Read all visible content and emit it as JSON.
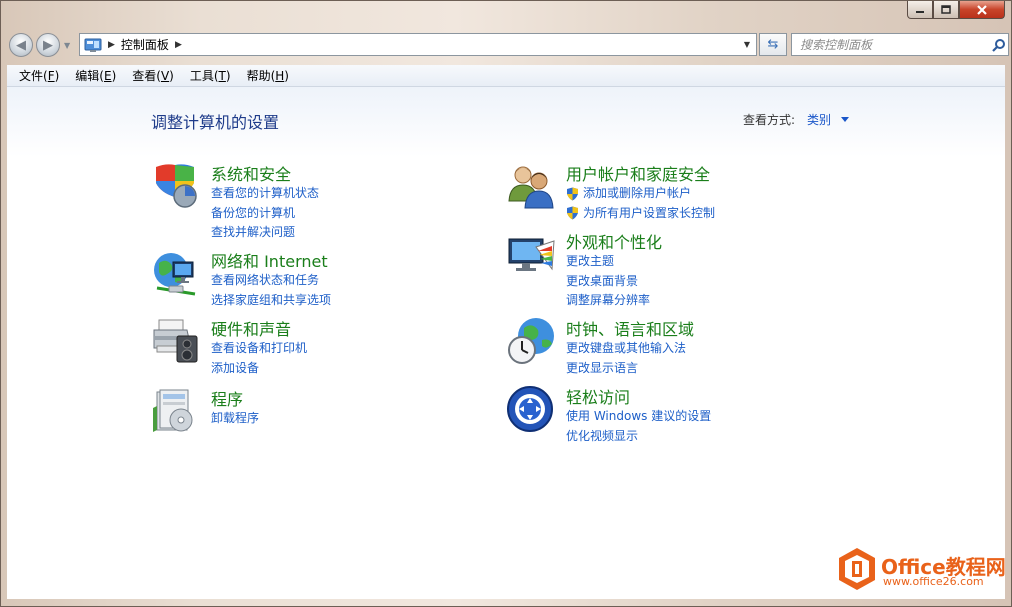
{
  "window": {
    "minimize_icon": "minimize-icon",
    "maximize_icon": "maximize-icon",
    "close_icon": "close-icon"
  },
  "nav": {
    "back_icon": "back-arrow-icon",
    "forward_icon": "forward-arrow-icon",
    "address": "控制面板",
    "search_placeholder": "搜索控制面板",
    "search_icon": "search-icon",
    "refresh_icon": "refresh-icon"
  },
  "menu": [
    "文件(F)",
    "编辑(E)",
    "查看(V)",
    "工具(T)",
    "帮助(H)"
  ],
  "menu_parts": [
    {
      "text": "文件(",
      "key": "F",
      "end": ")"
    },
    {
      "text": "编辑(",
      "key": "E",
      "end": ")"
    },
    {
      "text": "查看(",
      "key": "V",
      "end": ")"
    },
    {
      "text": "工具(",
      "key": "T",
      "end": ")"
    },
    {
      "text": "帮助(",
      "key": "H",
      "end": ")"
    }
  ],
  "page": {
    "title": "调整计算机的设置",
    "view_by_label": "查看方式:",
    "view_mode": "类别"
  },
  "categories": [
    {
      "title": "系统和安全",
      "icon": "system-security-icon",
      "links": [
        "查看您的计算机状态",
        "备份您的计算机",
        "查找并解决问题"
      ]
    },
    {
      "title": "网络和 Internet",
      "icon": "network-internet-icon",
      "links": [
        "查看网络状态和任务",
        "选择家庭组和共享选项"
      ]
    },
    {
      "title": "硬件和声音",
      "icon": "hardware-sound-icon",
      "links": [
        "查看设备和打印机",
        "添加设备"
      ]
    },
    {
      "title": "程序",
      "icon": "programs-icon",
      "links": [
        "卸载程序"
      ]
    },
    {
      "title": "用户帐户和家庭安全",
      "icon": "user-accounts-icon",
      "links": [
        "添加或删除用户帐户",
        "为所有用户设置家长控制"
      ]
    },
    {
      "title": "外观和个性化",
      "icon": "appearance-icon",
      "links": [
        "更改主题",
        "更改桌面背景",
        "调整屏幕分辨率"
      ]
    },
    {
      "title": "时钟、语言和区域",
      "icon": "clock-language-region-icon",
      "links": [
        "更改键盘或其他输入法",
        "更改显示语言"
      ]
    },
    {
      "title": "轻松访问",
      "icon": "ease-of-access-icon",
      "links": [
        "使用 Windows 建议的设置",
        "优化视频显示"
      ]
    }
  ],
  "watermark": {
    "title": "Office教程网",
    "url": "www.office26.com"
  },
  "colors": {
    "link": "#1e5fc8",
    "category_title": "#1a7e1a",
    "page_title": "#1e3b8a",
    "watermark": "#e9621a"
  }
}
